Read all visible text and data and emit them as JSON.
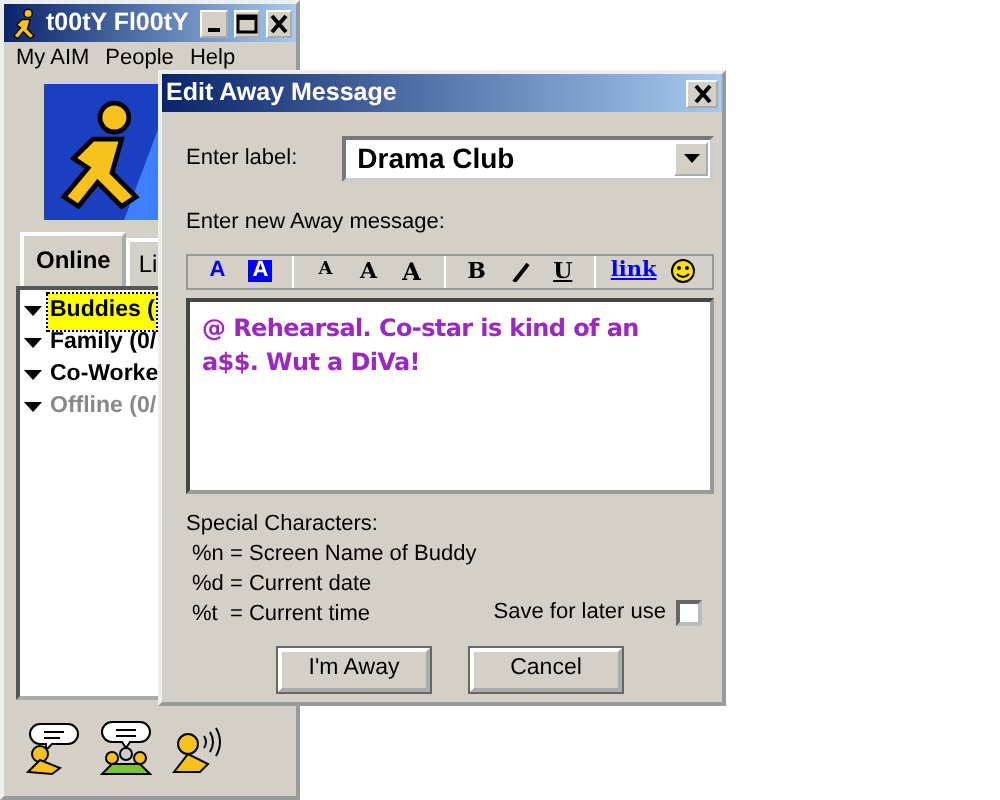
{
  "buddy_window": {
    "title": "t00tY Fl00tY",
    "menu": [
      "My AIM",
      "People",
      "Help"
    ],
    "tabs": [
      {
        "label": "Online",
        "selected": true
      },
      {
        "label": "Li",
        "selected": false
      }
    ],
    "groups": [
      {
        "label": "Buddies (",
        "selected": true,
        "expanded": true,
        "online": true
      },
      {
        "label": "Family (0/",
        "selected": false,
        "expanded": true,
        "online": true
      },
      {
        "label": "Co-Worke",
        "selected": false,
        "expanded": true,
        "online": true
      },
      {
        "label": "Offline (0/",
        "selected": false,
        "expanded": true,
        "online": false
      }
    ]
  },
  "dialog": {
    "title": "Edit Away Message",
    "label_prompt": "Enter label:",
    "label_value": "Drama Club",
    "message_prompt": "Enter new Away message:",
    "toolbar": [
      {
        "kind": "text-color",
        "label": "A"
      },
      {
        "kind": "back-color",
        "label": "A"
      },
      {
        "kind": "smaller",
        "label": "A"
      },
      {
        "kind": "normal",
        "label": "A"
      },
      {
        "kind": "larger",
        "label": "A"
      },
      {
        "kind": "bold",
        "label": "B"
      },
      {
        "kind": "italic"
      },
      {
        "kind": "underline",
        "label": "U"
      },
      {
        "kind": "link",
        "label": "link"
      },
      {
        "kind": "smiley"
      }
    ],
    "message": "@ Rehearsal. Co-star is kind of an a$$. Wut a DiVa!",
    "special_title": "Special Characters:",
    "special": [
      {
        "code": "%n",
        "meaning": "= Screen Name of Buddy"
      },
      {
        "code": "%d",
        "meaning": "= Current date"
      },
      {
        "code": "%t",
        "meaning": "= Current time"
      }
    ],
    "save_label": "Save for later use",
    "save_checked": false,
    "buttons": [
      "I'm Away",
      "Cancel"
    ]
  }
}
